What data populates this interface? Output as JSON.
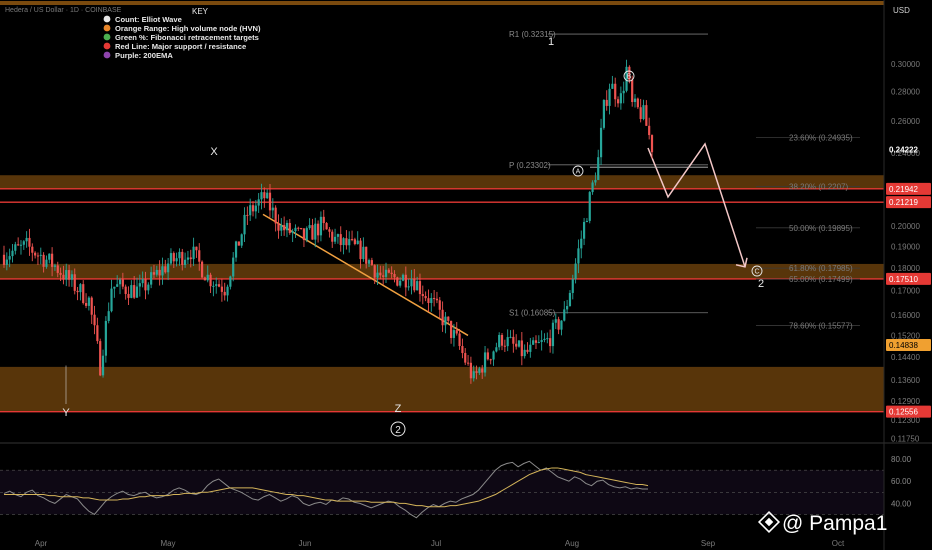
{
  "header": {
    "symbol": "Hedera / US Dollar · 1D · COINBASE",
    "currency": "USD"
  },
  "key": {
    "title": "KEY",
    "items": [
      {
        "label": "Count: Elliot Wave",
        "color": "#e8e8e8"
      },
      {
        "label": "Orange Range: High volume node (HVN)",
        "color": "#e8862a"
      },
      {
        "label": "Green %: Fibonacci retracement targets",
        "color": "#4caf50"
      },
      {
        "label": "Red Line: Major support / resistance",
        "color": "#e53935"
      },
      {
        "label": "Purple: 200EMA",
        "color": "#8e44ad"
      }
    ]
  },
  "colors": {
    "up": "#26a69a",
    "down": "#ef5350",
    "hvn": "#7a4a0e",
    "resistance": "#e53935",
    "trendline": "#f0a040",
    "projection": "#f3c7c7",
    "rsi_line": "#8a8a8a",
    "rsi_ma": "#d4b45a"
  },
  "chart_data": {
    "type": "candlestick",
    "y_axis": {
      "min": 0.117,
      "max": 0.345,
      "ticks": [
        "0.30000",
        "0.28000",
        "0.26000",
        "0.24000",
        "0.22000",
        "0.20000",
        "0.19000",
        "0.18000",
        "0.17000",
        "0.16000",
        "0.15200",
        "0.14400",
        "0.13600",
        "0.12900",
        "0.12300",
        "0.11750"
      ],
      "current_price": "0.24222"
    },
    "x_axis": {
      "labels": [
        "Apr",
        "May",
        "Jun",
        "Jul",
        "Aug",
        "Sep",
        "Oct"
      ]
    },
    "price_labels": [
      {
        "text": "0.21942",
        "value": 0.2194,
        "kind": "resistance"
      },
      {
        "text": "0.21219",
        "value": 0.2122,
        "kind": "resistance"
      },
      {
        "text": "0.17510",
        "value": 0.1751,
        "kind": "resistance"
      },
      {
        "text": "0.14838",
        "value": 0.1484,
        "kind": "orange"
      },
      {
        "text": "0.12556",
        "value": 0.1256,
        "kind": "resistance"
      }
    ],
    "hvn_zones": [
      [
        0.2194,
        0.227
      ],
      [
        0.1751,
        0.1818
      ],
      [
        0.1256,
        0.1405
      ]
    ],
    "pivots": [
      {
        "label": "R1 (0.32315)",
        "value": 0.3232
      },
      {
        "label": "P (0.23302)",
        "value": 0.233
      },
      {
        "label": "S1 (0.16085)",
        "value": 0.1609
      }
    ],
    "fib_levels": [
      {
        "label": "23.60% (0.24935)",
        "value": 0.2494
      },
      {
        "label": "38.20% (0.2207)",
        "value": 0.2207
      },
      {
        "label": "50.00% (0.19895)",
        "value": 0.199
      },
      {
        "label": "61.80% (0.17985)",
        "value": 0.1799
      },
      {
        "label": "65.00% (0.17499)",
        "value": 0.175
      },
      {
        "label": "78.60% (0.15577)",
        "value": 0.1558
      }
    ],
    "wave_labels": [
      "X",
      "Y",
      "Z",
      "1",
      "2",
      "A",
      "B",
      "C"
    ],
    "rsi": {
      "ticks": [
        "80.00",
        "60.00",
        "40.00"
      ],
      "values": [
        49,
        51,
        48,
        46,
        50,
        52,
        47,
        45,
        42,
        40,
        44,
        48,
        46,
        44,
        38,
        33,
        30,
        36,
        42,
        46,
        49,
        51,
        48,
        47,
        49,
        50,
        47,
        45,
        46,
        48,
        52,
        54,
        52,
        49,
        48,
        50,
        56,
        60,
        62,
        58,
        54,
        52,
        50,
        47,
        44,
        43,
        46,
        48,
        45,
        42,
        44,
        47,
        45,
        40,
        38,
        40,
        41,
        39,
        43,
        42,
        45,
        44,
        41,
        40,
        38,
        36,
        38,
        40,
        42,
        41,
        37,
        34,
        30,
        27,
        32,
        36,
        39,
        37,
        40,
        42,
        41,
        44,
        46,
        48,
        52,
        58,
        64,
        70,
        74,
        76,
        77,
        73,
        76,
        78,
        74,
        70,
        72,
        68,
        64,
        62,
        60,
        64,
        62,
        58,
        56,
        60,
        61,
        57,
        55,
        54,
        55,
        53,
        54,
        53,
        53
      ],
      "ma": [
        48,
        48,
        48,
        48,
        48,
        48,
        48,
        48,
        47,
        47,
        46,
        46,
        46,
        46,
        45,
        45,
        44,
        43,
        43,
        43,
        43,
        44,
        44,
        45,
        46,
        46,
        47,
        47,
        47,
        47,
        48,
        48,
        49,
        49,
        49,
        50,
        50,
        51,
        52,
        53,
        54,
        54,
        54,
        54,
        54,
        53,
        52,
        51,
        50,
        49,
        48,
        48,
        47,
        47,
        46,
        45,
        44,
        43,
        43,
        42,
        42,
        42,
        42,
        42,
        42,
        41,
        41,
        41,
        41,
        41,
        40,
        40,
        39,
        38,
        38,
        37,
        37,
        37,
        37,
        38,
        38,
        39,
        40,
        41,
        42,
        44,
        46,
        48,
        51,
        54,
        57,
        60,
        63,
        66,
        68,
        70,
        71,
        72,
        72,
        71,
        70,
        69,
        68,
        66,
        65,
        64,
        63,
        62,
        61,
        60,
        59,
        58,
        57,
        57,
        56
      ]
    },
    "watermark": "@ Pampa1"
  }
}
